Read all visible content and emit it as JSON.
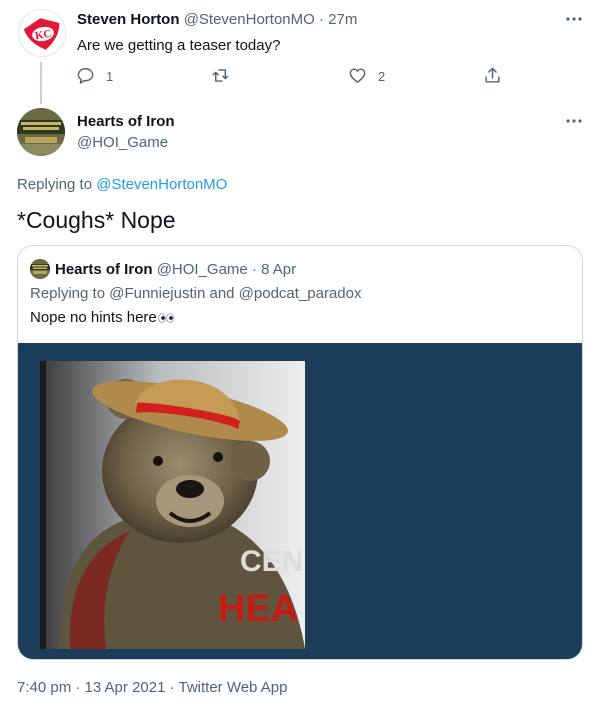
{
  "reply_tweet": {
    "name": "Steven Horton",
    "handle": "@StevenHortonMO",
    "separator": "·",
    "time": "27m",
    "text": "Are we getting a teaser today?",
    "actions": {
      "reply_count": "1",
      "retweet_count": "",
      "like_count": "2"
    },
    "avatar_icon": "chiefs-logo-icon",
    "avatar_color": "#e31837"
  },
  "main_tweet": {
    "name": "Hearts of Iron",
    "handle": "@HOI_Game",
    "replying_prefix": "Replying to ",
    "replying_to": "@StevenHortonMO",
    "text": "*Coughs* Nope",
    "timestamp": "7:40 pm · 13 Apr 2021 · Twitter Web App",
    "avatar_icon": "hearts-of-iron-logo-icon"
  },
  "quoted_tweet": {
    "name": "Hearts of Iron",
    "handle": "@HOI_Game",
    "separator": "·",
    "date": "8 Apr",
    "replying_line": "Replying to @Funniejustin and @podcat_paradox",
    "text": "Nope no hints here",
    "emoji_icon": "eyes-emoji-icon",
    "media_bg": "#1c3d59",
    "image_text_1": "CEN",
    "image_text_2": "HEA"
  },
  "colors": {
    "link": "#1d9bf0",
    "secondary_text": "#536471",
    "border": "#cfd9de"
  }
}
